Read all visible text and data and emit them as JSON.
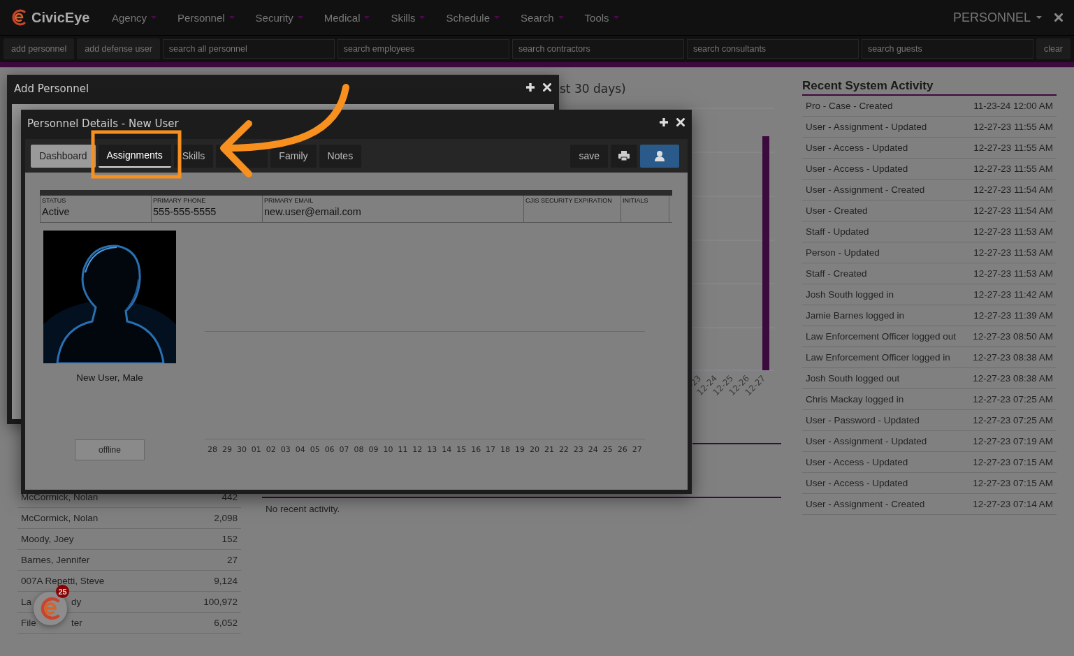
{
  "app": {
    "name": "CivicEye"
  },
  "nav": [
    {
      "label": "Agency"
    },
    {
      "label": "Personnel"
    },
    {
      "label": "Security"
    },
    {
      "label": "Medical"
    },
    {
      "label": "Skills"
    },
    {
      "label": "Schedule"
    },
    {
      "label": "Search"
    },
    {
      "label": "Tools"
    }
  ],
  "module_menu": {
    "label": "PERSONNEL"
  },
  "toolbar": [
    {
      "kind": "button",
      "label": "add personnel"
    },
    {
      "kind": "button",
      "label": "add defense user"
    },
    {
      "kind": "field",
      "placeholder": "search all personnel"
    },
    {
      "kind": "field",
      "placeholder": "search employees"
    },
    {
      "kind": "field",
      "placeholder": "search contractors"
    },
    {
      "kind": "field",
      "placeholder": "search consultants"
    },
    {
      "kind": "field",
      "placeholder": "search guests"
    },
    {
      "kind": "button",
      "label": "clear"
    }
  ],
  "personnel_table": {
    "rows": [
      {
        "name": "McCormick, Nolan",
        "count": "442"
      },
      {
        "name": "McCormick, Nolan",
        "count": "2,098"
      },
      {
        "name": "Moody, Joey",
        "count": "152"
      },
      {
        "name": "Barnes, Jennifer",
        "count": "27"
      },
      {
        "name": "007A Repetti, Steve",
        "count": "9,124"
      },
      {
        "name": "La",
        "name_tail": "dy",
        "count": "100,972"
      },
      {
        "name": "File",
        "name_tail": "ter",
        "count": "6,052"
      }
    ]
  },
  "activity_chart": {
    "title": "st 30 days)",
    "date_labels": [
      "-23",
      "12-24",
      "12-25",
      "12-26",
      "12-27"
    ]
  },
  "recent_activity_panel": {
    "message": "No recent activity."
  },
  "recent_system_activity": {
    "title": "Recent System Activity",
    "rows": [
      {
        "event": "Pro - Case - Created",
        "time": "11-23-24 12:00 AM"
      },
      {
        "event": "User - Assignment - Updated",
        "time": "12-27-23 11:55 AM"
      },
      {
        "event": "User - Access - Updated",
        "time": "12-27-23 11:55 AM"
      },
      {
        "event": "User - Access - Updated",
        "time": "12-27-23 11:55 AM"
      },
      {
        "event": "User - Assignment - Created",
        "time": "12-27-23 11:54 AM"
      },
      {
        "event": "User - Created",
        "time": "12-27-23 11:54 AM"
      },
      {
        "event": "Staff - Updated",
        "time": "12-27-23 11:53 AM"
      },
      {
        "event": "Person - Updated",
        "time": "12-27-23 11:53 AM"
      },
      {
        "event": "Staff - Created",
        "time": "12-27-23 11:53 AM"
      },
      {
        "event": "Josh South logged in",
        "time": "12-27-23 11:42 AM"
      },
      {
        "event": "Jamie Barnes logged in",
        "time": "12-27-23 11:39 AM"
      },
      {
        "event": "Law Enforcement Officer logged out",
        "time": "12-27-23 08:50 AM"
      },
      {
        "event": "Law Enforcement Officer logged in",
        "time": "12-27-23 08:38 AM"
      },
      {
        "event": "Josh South logged out",
        "time": "12-27-23 08:38 AM"
      },
      {
        "event": "Chris Mackay logged in",
        "time": "12-27-23 07:25 AM"
      },
      {
        "event": "User - Password - Updated",
        "time": "12-27-23 07:25 AM"
      },
      {
        "event": "User - Assignment - Updated",
        "time": "12-27-23 07:19 AM"
      },
      {
        "event": "User - Access - Updated",
        "time": "12-27-23 07:15 AM"
      },
      {
        "event": "User - Access - Updated",
        "time": "12-27-23 07:15 AM"
      },
      {
        "event": "User - Assignment - Created",
        "time": "12-27-23 07:14 AM"
      }
    ]
  },
  "add_personnel_dialog": {
    "title": "Add Personnel"
  },
  "personnel_details_dialog": {
    "title": "Personnel Details - New User",
    "tabs": [
      {
        "label": "Dashboard",
        "selected": true,
        "hovered": false
      },
      {
        "label": "Assignments",
        "selected": false,
        "hovered": true
      },
      {
        "label": "Skills",
        "selected": false,
        "hovered": false
      },
      {
        "selected": false,
        "hovered": false
      },
      {
        "label": "Family",
        "selected": false,
        "hovered": false
      },
      {
        "label": "Notes",
        "selected": false,
        "hovered": false
      }
    ],
    "save_button": "save",
    "info": [
      {
        "label": "STATUS",
        "value": "Active"
      },
      {
        "label": "PRIMARY PHONE",
        "value": "555-555-5555"
      },
      {
        "label": "PRIMARY EMAIL",
        "value": "new.user@email.com"
      },
      {
        "label": "CJIS SECURITY EXPIRATION"
      },
      {
        "label": "INITIALS"
      }
    ],
    "caption": "New User, Male",
    "presence": "offline",
    "day_labels": [
      "28",
      "29",
      "30",
      "01",
      "02",
      "03",
      "04",
      "05",
      "06",
      "07",
      "08",
      "09",
      "10",
      "11",
      "12",
      "13",
      "14",
      "15",
      "16",
      "17",
      "18",
      "19",
      "20",
      "21",
      "22",
      "23",
      "24",
      "25",
      "26",
      "27"
    ]
  },
  "chat_launcher": {
    "badge": "25"
  }
}
